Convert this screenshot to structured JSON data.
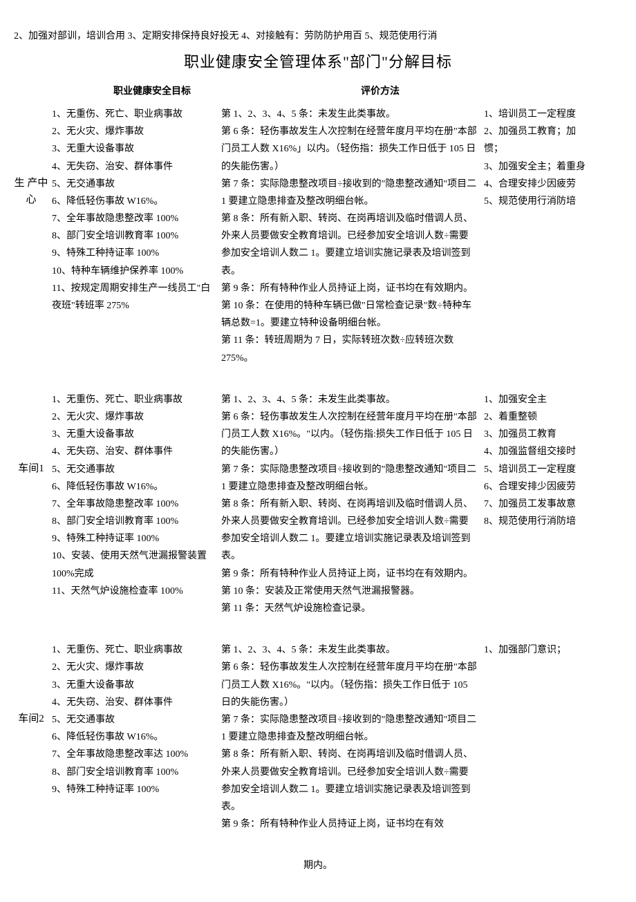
{
  "header_line": "2、加强对部训，培训合用 3、定期安排保持良好投无 4、对接触有：劳防防护用百 5、规范使用行消",
  "title": "职业健康安全管理体系\"部门\"分解目标",
  "column_headers": {
    "goals": "职业健康安全目标",
    "evaluation": "评价方法"
  },
  "sections": [
    {
      "dept": "生 产中心",
      "goals": [
        "1、无重伤、死亡、职业病事故",
        "2、无火灾、爆炸事故",
        "3、无重大设备事故",
        "4、无失窃、治安、群体事件",
        "5、无交通事故",
        "6、降低轻伤事故 W16%。",
        "7、全年事故隐患整改率 100%",
        "8、部门安全培训教育率 100%",
        "9、特殊工种持证率 100%",
        "10、特种车辆维护保养率 100%",
        "11、按规定周期安排生产一线员工\"白夜班\"转班率 275%"
      ],
      "evaluation": [
        "第 1、2、3、4、5 条：未发生此类事故。",
        "第 6 条：轻伤事故发生人次控制在经营年度月平均在册\"本部门员工人数 X16%」以内。（轻伤指：损失工作日低于 105 日的失能伤害。）",
        "第 7 条：实际隐患整改项目÷接收到的\"隐患整改通知\"项目二 1 要建立隐患排查及整改明细台帐。",
        "第 8 条：所有新入职、转岗、在岗再培训及临时借调人员、外来人员要做安全教育培训。已经参加安全培训人数÷需要参加安全培训人数二 1。要建立培训实施记录表及培训签到表。",
        "第 9 条：所有特种作业人员持证上岗，证书均在有效期内。",
        "第 10 条：在使用的特种车辆已做\"日常检查记录\"数÷特种车辆总数=1。要建立特种设备明细台帐。",
        "第 11 条：转班周期为 7 日，实际转班次数÷应转班次数275%。"
      ],
      "measures": [
        "1、培训员工一定程度",
        "2、加强员工教育；加惯；",
        "3、加强安全主；着重身",
        "4、合理安排少因疲劳",
        "5、规范使用行消防培"
      ]
    },
    {
      "dept": "车间1",
      "goals": [
        "1、无重伤、死亡、职业病事故",
        "2、无火灾、爆炸事故",
        "3、无重大设备事故",
        "4、无失窃、治安、群体事件",
        "5、无交通事故",
        "6、降低轻伤事故 W16%。",
        "7、全年事故隐患整改率 100%",
        "8、部门安全培训教育率 100%",
        "9、特殊工种持证率 100%",
        "10、安装、使用天然气泄漏报警装置 100%完成",
        "11、天然气炉设施检查率 100%"
      ],
      "evaluation": [
        "第 1、2、3、4、5 条：未发生此类事故。",
        "第 6 条：轻伤事故发生人次控制在经营年度月平均在册\"本部门员工人数 X16%。\"以内。（轻伤指:损失工作日低于 105 日的失能伤害。）",
        "第 7 条：实际隐患整改项目÷接收到的\"隐患整改通知\"项目二 1 要建立隐患排查及整改明细台帐。",
        "第 8 条：所有新入职、转岗、在岗再培训及临时借调人员、外来人员要做安全教育培训。已经参加安全培训人数÷需要参加安全培训人数二 1。要建立培训实施记录表及培训签到表。",
        "第 9 条：所有特种作业人员持证上岗，证书均在有效期内。",
        "第 10 条：安装及正常使用天然气泄漏报警器。",
        "第 11 条：天然气炉设施检查记录。"
      ],
      "measures": [
        "1、加强安全主",
        "2、着重整顿",
        "3、加强员工教育",
        "4、加强监督组交接时",
        "5、培训员工一定程度",
        "6、合理安排少因疲劳",
        "7、加强员工发事故意",
        "8、规范使用行消防培"
      ]
    },
    {
      "dept": "车间2",
      "goals": [
        "1、无重伤、死亡、职业病事故",
        "2、无火灾、爆炸事故",
        "3、无重大设备事故",
        "4、无失窃、治安、群体事件",
        "5、无交通事故",
        "6、降低轻伤事故 W16%。",
        "7、全年事故隐患整改率达 100%",
        "8、部门安全培训教育率 100%",
        "9、特殊工种持证率 100%"
      ],
      "evaluation": [
        "第 1、2、3、4、5 条：未发生此类事故。",
        "第 6 条：轻伤事故发生人次控制在经营年度月平均在册\"本部门员工人数 X16%。\"以内。（轻伤指：损失工作日低于 105日的失能伤害。）",
        "第 7 条：实际隐患整改项目÷接收到的\"隐患整改通知\"项目二 1 要建立隐患排查及整改明细台帐。",
        "第 8 条：所有新入职、转岗、在岗再培训及临时借调人员、外来人员要做安全教育培训。已经参加安全培训人数÷需要参加安全培训人数二 1。要建立培训实施记录表及培训签到表。",
        "第 9 条：所有特种作业人员持证上岗，证书均在有效"
      ],
      "measures": [
        "1、加强部门意识；"
      ]
    }
  ],
  "footer": "期内。"
}
